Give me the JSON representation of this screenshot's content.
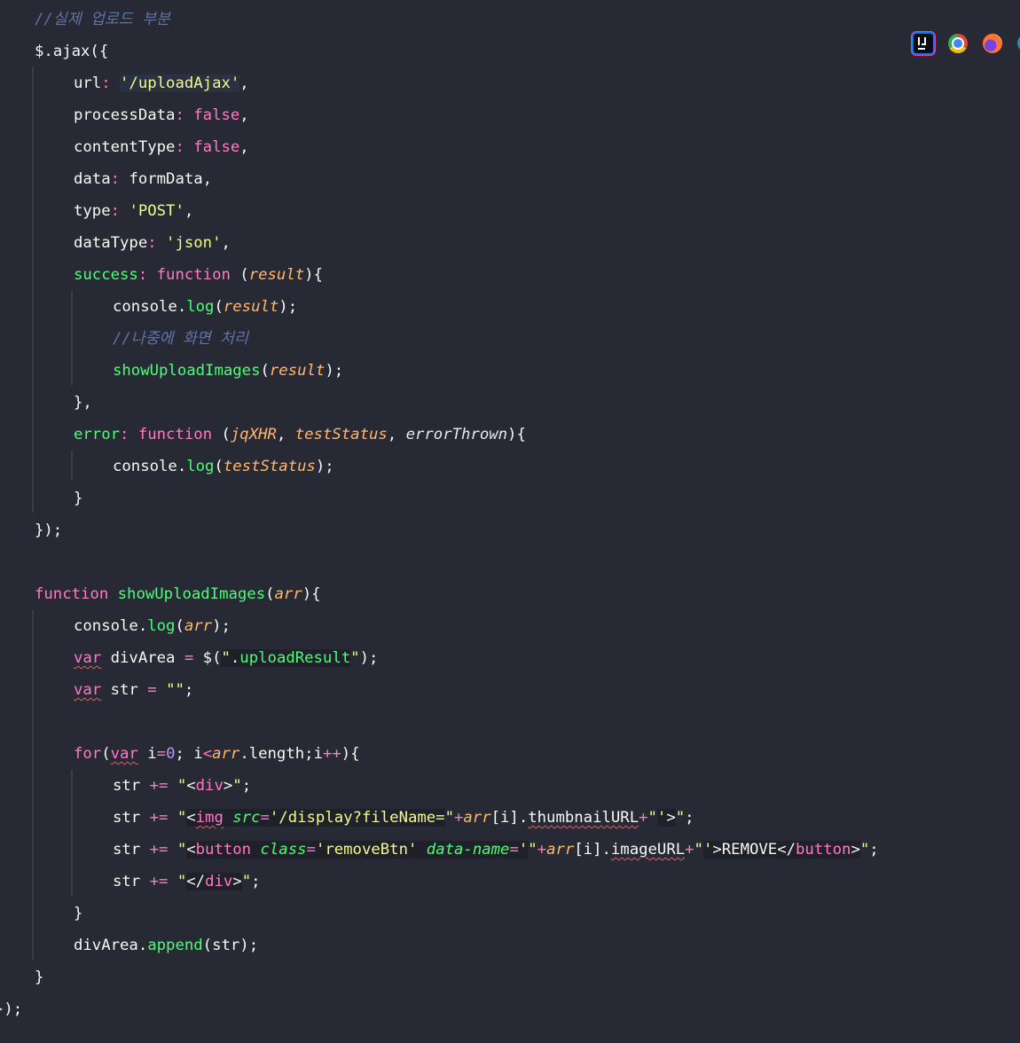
{
  "toolbar": {
    "icons": [
      "intellij-icon",
      "chrome-icon",
      "firefox-icon",
      "edge-icon"
    ],
    "colors": {
      "intellij": "#087cfa",
      "chrome": "#ea4335",
      "firefox": "#ff7139",
      "edge": "#1a8fd6"
    }
  },
  "theme": {
    "background": "#272935",
    "foreground": "#f8f8f2",
    "comment": "#6272a4",
    "keyword": "#ff79c6",
    "function": "#50fa7b",
    "string": "#f1fa8c",
    "param": "#ffb86c",
    "number": "#bd93f9"
  },
  "code": {
    "l01": {
      "t1": "//실제 업로드 부분"
    },
    "l02": {
      "t1": "$.ajax({"
    },
    "l03": {
      "t1": "url",
      "t2": ": ",
      "t3": "'/uploadAjax'",
      "t4": ","
    },
    "l04": {
      "t1": "processData",
      "t2": ": ",
      "t3": "false",
      "t4": ","
    },
    "l05": {
      "t1": "contentType",
      "t2": ": ",
      "t3": "false",
      "t4": ","
    },
    "l06": {
      "t1": "data",
      "t2": ": ",
      "t3": "formData,"
    },
    "l07": {
      "t1": "type",
      "t2": ": ",
      "t3": "'POST'",
      "t4": ","
    },
    "l08": {
      "t1": "dataType",
      "t2": ": ",
      "t3": "'json'",
      "t4": ","
    },
    "l09": {
      "t1": "success",
      "t2": ": ",
      "t3": "function",
      "t4": " (",
      "t5": "result",
      "t6": "){"
    },
    "l10": {
      "t1": "console.",
      "t2": "log",
      "t3": "(",
      "t4": "result",
      "t5": ");"
    },
    "l11": {
      "t1": "//나중에 화면 처리"
    },
    "l12": {
      "t1": "showUploadImages",
      "t2": "(",
      "t3": "result",
      "t4": ");"
    },
    "l13": {
      "t1": "},"
    },
    "l14": {
      "t1": "error",
      "t2": ": ",
      "t3": "function",
      "t4": " (",
      "t5": "jqXHR",
      "t6": ", ",
      "t7": "testStatus",
      "t8": ", ",
      "t9": "errorThrown",
      "t10": "){"
    },
    "l15": {
      "t1": "console.",
      "t2": "log",
      "t3": "(",
      "t4": "testStatus",
      "t5": ");"
    },
    "l16": {
      "t1": "}"
    },
    "l17": {
      "t1": "});"
    },
    "l18": {
      "t1": "function",
      "t2": " ",
      "t3": "showUploadImages",
      "t4": "(",
      "t5": "arr",
      "t6": "){"
    },
    "l19": {
      "t1": "console.",
      "t2": "log",
      "t3": "(",
      "t4": "arr",
      "t5": ");"
    },
    "l20": {
      "t1": "var",
      "t2": " divArea ",
      "t3": "=",
      "t4": " $(",
      "t5": "\"",
      "t6": ".",
      "t7": "uploadResult",
      "t8": "\"",
      "t9": ");"
    },
    "l21": {
      "t1": "var",
      "t2": " str ",
      "t3": "=",
      "t4": " ",
      "t5": "\"\"",
      "t6": ";"
    },
    "l22": {
      "t1": "for",
      "t2": "(",
      "t3": "var",
      "t4": " i",
      "t5": "=",
      "t6": "0",
      "t7": "; i",
      "t8": "<",
      "t9": "arr",
      "t10": ".length;i",
      "t11": "++",
      "t12": "){"
    },
    "l23": {
      "t1": "str ",
      "t2": "+=",
      "t3": " ",
      "t4": "\"",
      "t5": "<",
      "t6": "div",
      "t7": ">",
      "t8": "\"",
      "t9": ";"
    },
    "l24": {
      "t1": "str ",
      "t2": "+=",
      "t3": " ",
      "t4": "\"",
      "t5": "<",
      "t6": "img",
      "t7": " ",
      "t8": "src",
      "t9": "=",
      "t10": "'/display?fileName=",
      "t11": "\"",
      "t12": "+",
      "t13": "arr",
      "t14": "[i].",
      "t15": "thumbnailURL",
      "t16": "+",
      "t17": "\"",
      "t18": "'",
      "t19": ">",
      "t20": "\"",
      "t21": ";"
    },
    "l25": {
      "t1": "str ",
      "t2": "+=",
      "t3": " ",
      "t4": "\"",
      "t5": "<",
      "t6": "button",
      "t7": " ",
      "t8": "class",
      "t9": "=",
      "t10": "'removeBtn'",
      "t11": " ",
      "t12": "data-name",
      "t13": "=",
      "t14": "'",
      "t15": "\"",
      "t16": "+",
      "t17": "arr",
      "t18": "[i].",
      "t19": "imageURL",
      "t20": "+",
      "t21": "\"",
      "t22": "'",
      "t23": ">REMOVE",
      "t24": "</",
      "t25": "button",
      "t26": ">",
      "t27": "\"",
      "t28": ";"
    },
    "l26": {
      "t1": "str ",
      "t2": "+=",
      "t3": " ",
      "t4": "\"",
      "t5": "</",
      "t6": "div",
      "t7": ">",
      "t8": "\"",
      "t9": ";"
    },
    "l27": {
      "t1": "}"
    },
    "l28": {
      "t1": "divArea.",
      "t2": "append",
      "t3": "(str);"
    },
    "l29": {
      "t1": "}"
    },
    "l30": {
      "t1": "});"
    }
  }
}
